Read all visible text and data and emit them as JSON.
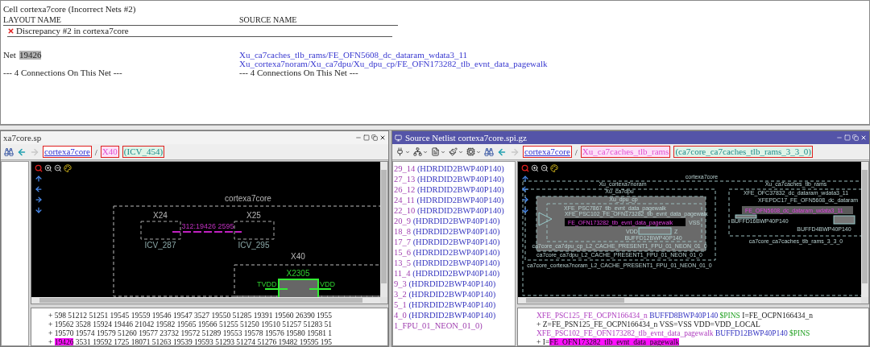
{
  "report": {
    "title": "Cell cortexa7core (Incorrect Nets #2)",
    "columns": [
      "LAYOUT NAME",
      "SOURCE NAME"
    ],
    "discrepancy": "Discrepancy #2 in cortexa7core",
    "net_label": "Net",
    "net_id": "19426",
    "source_nets": [
      "Xu_ca7caches_tlb_rams/FE_OFN5608_dc_dataram_wdata3_11",
      "Xu_cortexa7noram/Xu_ca7dpu/Xu_dpu_cp/FE_OFN173282_tlb_evnt_data_pagewalk"
    ],
    "layout_connections": "--- 4 Connections On This Net ---",
    "source_connections": "--- 4 Connections On This Net ---"
  },
  "layout_window": {
    "title": "xa7core.sp",
    "active": false,
    "breadcrumb": [
      {
        "kind": "cell",
        "text": "cortexa7core"
      },
      {
        "kind": "sep",
        "text": "/"
      },
      {
        "kind": "instance",
        "text": "X40"
      },
      {
        "kind": "type",
        "text": "(ICV_454)"
      }
    ],
    "schematic": {
      "top": "cortexa7core",
      "blocks": [
        {
          "name": "X24",
          "cell": "ICV_287"
        },
        {
          "name": "X25",
          "cell": "ICV_295"
        }
      ],
      "net": "312:19426 2595",
      "instance": "X40",
      "device": "X2305",
      "pins": [
        "TVDD",
        "VDD"
      ]
    },
    "netlist_lines": [
      [
        {
          "kind": "plain",
          "text": "+ 598 51212 51251 19545 19559 19546 19547 3527 19550 51285 19391 19560 26390 1955"
        }
      ],
      [
        {
          "kind": "plain",
          "text": "+ 19562 3528 15924 19446 21042 19582 19565 19566 51255 51250 19510 51257 51283 51"
        }
      ],
      [
        {
          "kind": "plain",
          "text": "+ 19570 19574 19579 51260 19577 23732 19572 51289 19553 19578 19576 19580 19581 1"
        }
      ],
      [
        {
          "kind": "plain",
          "text": "+ "
        },
        {
          "kind": "highlight",
          "text": "19426"
        },
        {
          "kind": "plain",
          "text": " 3531 19592 1725 18071 51263 19539 19593 51293 51274 51276 19482 19595 195"
        }
      ]
    ]
  },
  "source_window": {
    "title": "Source Netlist cortexa7core.spi.gz",
    "active": true,
    "breadcrumb": [
      {
        "kind": "cell",
        "text": "cortexa7core"
      },
      {
        "kind": "sep",
        "text": "/"
      },
      {
        "kind": "instance",
        "text": "Xu_ca7caches_tlb_rams"
      },
      {
        "kind": "type",
        "text": "(ca7core_ca7caches_tlb_rams_3_3_0)"
      }
    ],
    "tree_items": [
      {
        "id": "29_14",
        "cell": "(HDRDID2BWP40P140)"
      },
      {
        "id": "27_13",
        "cell": "(HDRDID2BWP40P140)"
      },
      {
        "id": "26_12",
        "cell": "(HDRDID2BWP40P140)"
      },
      {
        "id": "24_11",
        "cell": "(HDRDID2BWP40P140)"
      },
      {
        "id": "22_10",
        "cell": "(HDRDID2BWP40P140)"
      },
      {
        "id": "20_9",
        "cell": "(HDRDID2BWP40P140)"
      },
      {
        "id": "18_8",
        "cell": "(HDRDID2BWP40P140)"
      },
      {
        "id": "17_7",
        "cell": "(HDRDID2BWP40P140)"
      },
      {
        "id": "15_6",
        "cell": "(HDRDID2BWP40P140)"
      },
      {
        "id": "13_5",
        "cell": "(HDRDID2BWP40P140)"
      },
      {
        "id": "11_4",
        "cell": "(HDRDID2BWP40P140)"
      },
      {
        "id": "9_3",
        "cell": "(HDRDID2BWP40P140)"
      },
      {
        "id": "3_2",
        "cell": "(HDRDID2BWP40P140)"
      },
      {
        "id": "5_1",
        "cell": "(HDRDID2BWP40P140)"
      },
      {
        "id": "4_0",
        "cell": "(HDRDID2BWP40P140)"
      },
      {
        "id": "1_FPU_01_NEON_01_0)"
      }
    ],
    "schematic": {
      "top": "cortexa7core",
      "groups": [
        "Xu_cortexa7noram",
        "Xu_ca7caches_tlb_rams",
        "Xu_ca7dpu",
        "Xu_dpu_cp"
      ],
      "group_cells": [
        "ca7core_ca7caches_tlb_rams_3_3_0",
        "ca7core_ca7dpu_cp_L2_CACHE_PRESENT1_FPU_01_NEON_01_0",
        "ca7core_ca7dpu_L2_CACHE_PRESENT1_FPU_01_NEON_01_0",
        "ca7core_cortexa7noram_L2_CACHE_PRESENT1_FPU_01_NEON_01_0"
      ],
      "instances": [
        "XFE_PSC7867_tlb_evnt_data_pagewalk",
        "XFE_PSC102_FE_OFN173282_tlb_evnt_data_pagewalk",
        "XFE_OFC37832_dc_dataram_wdata3_11",
        "XFEPDC17_FE_OFN5608_dc_dataram"
      ],
      "nets": [
        "FE_OFN173282_tlb_evnt_data_pagewalk",
        "FE_OFN5608_dc_dataram_wdata3_11"
      ],
      "cells": [
        "BUFFD12BWP40P140",
        "BUFFD16BWP40P140",
        "BUFFD4BWP40P140"
      ],
      "pins": [
        "VSS",
        "VDD",
        "Z"
      ]
    },
    "netlist_lines": [
      [
        {
          "kind": "instance",
          "text": "XFE_PSC125_FE_OCPN166434_n"
        },
        {
          "kind": "cell",
          "text": " BUFFD8BWP40P140"
        },
        {
          "kind": "pins",
          "text": " $PINS"
        },
        {
          "kind": "plain",
          "text": " I=FE_OCPN166434_n"
        }
      ],
      [
        {
          "kind": "plain",
          "text": "+ Z=FE_PSN125_FE_OCPN166434_n VSS=VSS VDD=VDD_LOCAL"
        }
      ],
      [
        {
          "kind": "instance",
          "text": "XFE_PSC102_FE_OFN173282_tlb_evnt_data_pagewalk"
        },
        {
          "kind": "cell",
          "text": " BUFFD12BWP40P140"
        },
        {
          "kind": "pins",
          "text": " $PINS"
        }
      ],
      [
        {
          "kind": "plain",
          "text": "+ I="
        },
        {
          "kind": "highlight",
          "text": "FE_OFN173282_tlb_evnt_data_pagewalk"
        }
      ]
    ]
  }
}
